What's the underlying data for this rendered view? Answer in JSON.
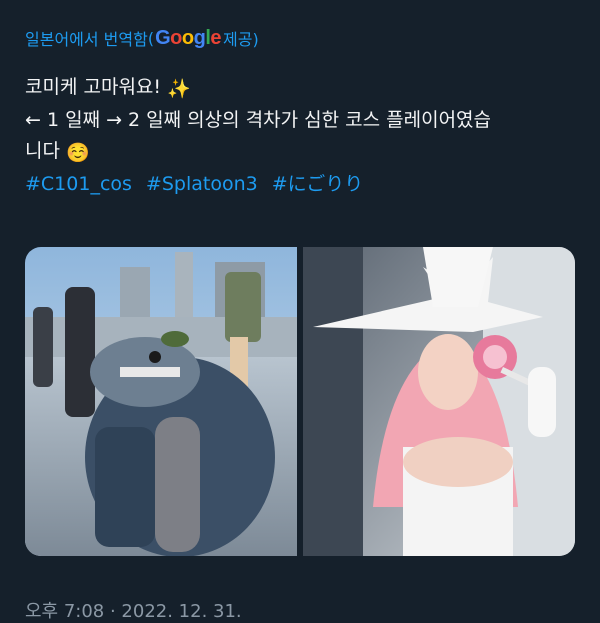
{
  "translation": {
    "prefix": "일본어에서 번역함",
    "paren_open": "(",
    "google_letters": [
      "G",
      "o",
      "o",
      "g",
      "l",
      "e"
    ],
    "suffix": "제공)"
  },
  "tweet": {
    "line1": "코미케 고마워요!",
    "line1_emoji": "✨",
    "line2": "← 1 일째 → 2 일째 의상의 격차가 심한 코스 플레이어였습",
    "line3": "니다",
    "line3_emoji": "☺️",
    "hashtags": [
      "#C101_cos",
      "#Splatoon3",
      "#にごりり"
    ]
  },
  "media": {
    "left_photo": "cosplay-day1-fish-costume",
    "right_photo": "cosplay-day2-white-witch"
  },
  "timestamp": "오후 7:08 · 2022. 12. 31."
}
